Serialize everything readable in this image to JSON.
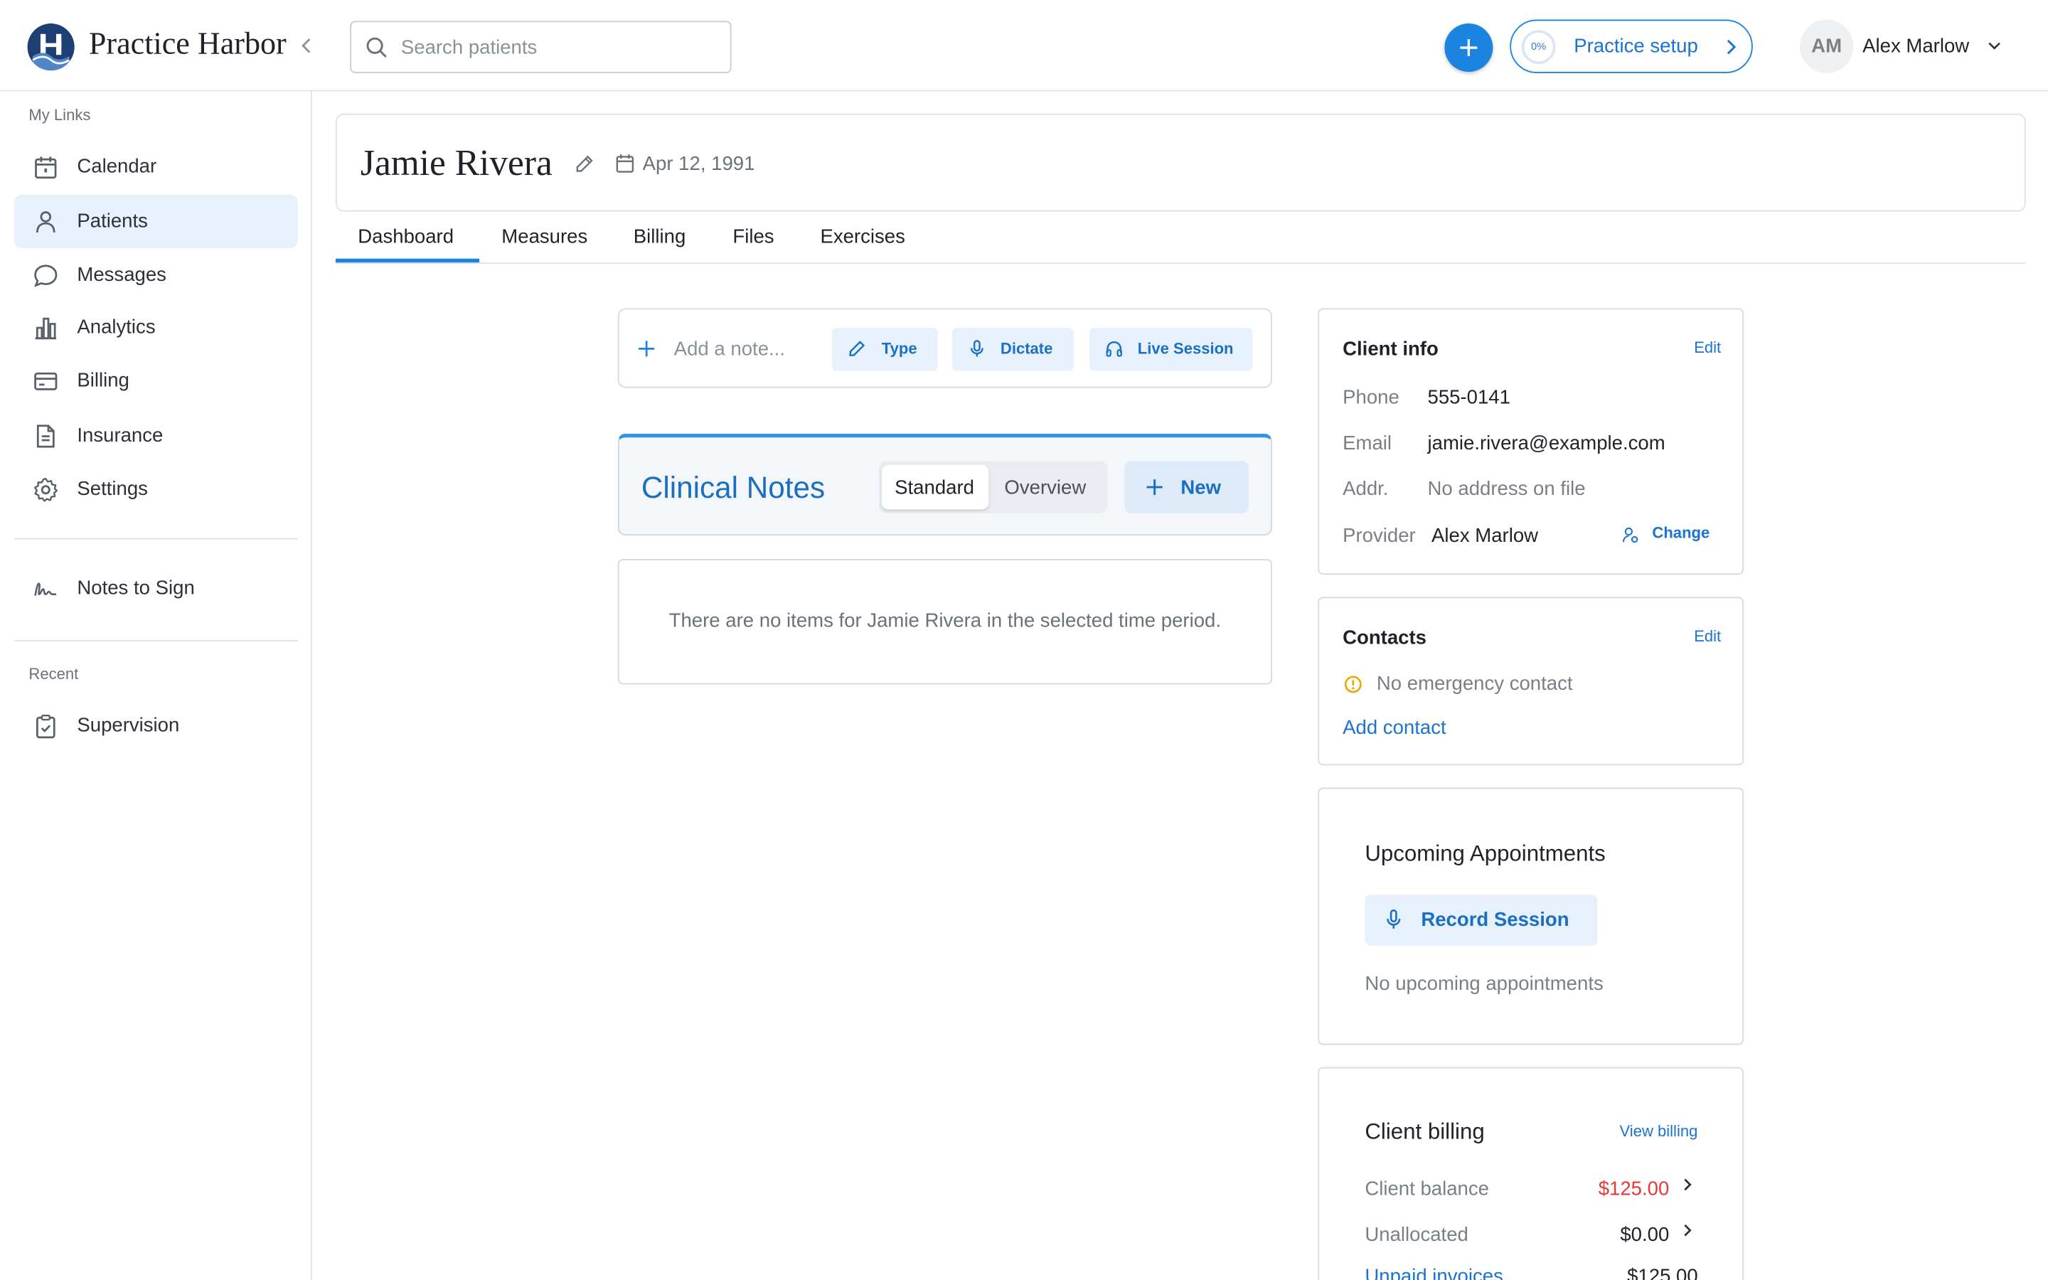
{
  "app": {
    "brand": "Practice Harbor",
    "search_placeholder": "Search patients",
    "setup_progress": "0%",
    "setup_label": "Practice setup",
    "user_initials": "AM",
    "user_name": "Alex Marlow"
  },
  "sidebar": {
    "my_links_label": "My Links",
    "items": [
      {
        "label": "Calendar",
        "icon": "calendar-icon"
      },
      {
        "label": "Patients",
        "icon": "person-icon",
        "active": true
      },
      {
        "label": "Messages",
        "icon": "chat-icon"
      },
      {
        "label": "Analytics",
        "icon": "bar-chart-icon"
      },
      {
        "label": "Billing",
        "icon": "card-icon"
      },
      {
        "label": "Insurance",
        "icon": "document-icon"
      },
      {
        "label": "Settings",
        "icon": "gear-icon"
      }
    ],
    "notes_to_sign": "Notes to Sign",
    "recent_label": "Recent",
    "recent_items": [
      {
        "label": "Supervision",
        "icon": "clipboard-check-icon"
      }
    ]
  },
  "patient": {
    "name": "Jamie Rivera",
    "dob": "Apr 12, 1991"
  },
  "tabs": [
    "Dashboard",
    "Measures",
    "Billing",
    "Files",
    "Exercises"
  ],
  "notebar": {
    "placeholder": "Add a note...",
    "type_label": "Type",
    "dictate_label": "Dictate",
    "live_label": "Live Session"
  },
  "clinical_notes": {
    "title": "Clinical Notes",
    "seg_standard": "Standard",
    "seg_overview": "Overview",
    "new_label": "New",
    "empty_text": "There are no items for Jamie Rivera in the selected time period."
  },
  "client_info": {
    "title": "Client info",
    "edit": "Edit",
    "phone_label": "Phone",
    "phone": "555-0141",
    "email_label": "Email",
    "email": "jamie.rivera@example.com",
    "addr_label": "Addr.",
    "addr": "No address on file",
    "provider_label": "Provider",
    "provider": "Alex Marlow",
    "change": "Change"
  },
  "contacts": {
    "title": "Contacts",
    "edit": "Edit",
    "warning": "No emergency contact",
    "add": "Add contact"
  },
  "appointments": {
    "title": "Upcoming Appointments",
    "record": "Record Session",
    "empty": "No upcoming appointments"
  },
  "billing": {
    "title": "Client billing",
    "view": "View billing",
    "balance_label": "Client balance",
    "balance": "$125.00",
    "unallocated_label": "Unallocated",
    "unallocated": "$0.00",
    "unpaid_label": "Unpaid invoices",
    "unpaid": "$125.00"
  },
  "colors": {
    "accent": "#1a84e0",
    "link": "#1a73d0",
    "danger": "#e53935",
    "warning": "#e6a700"
  }
}
